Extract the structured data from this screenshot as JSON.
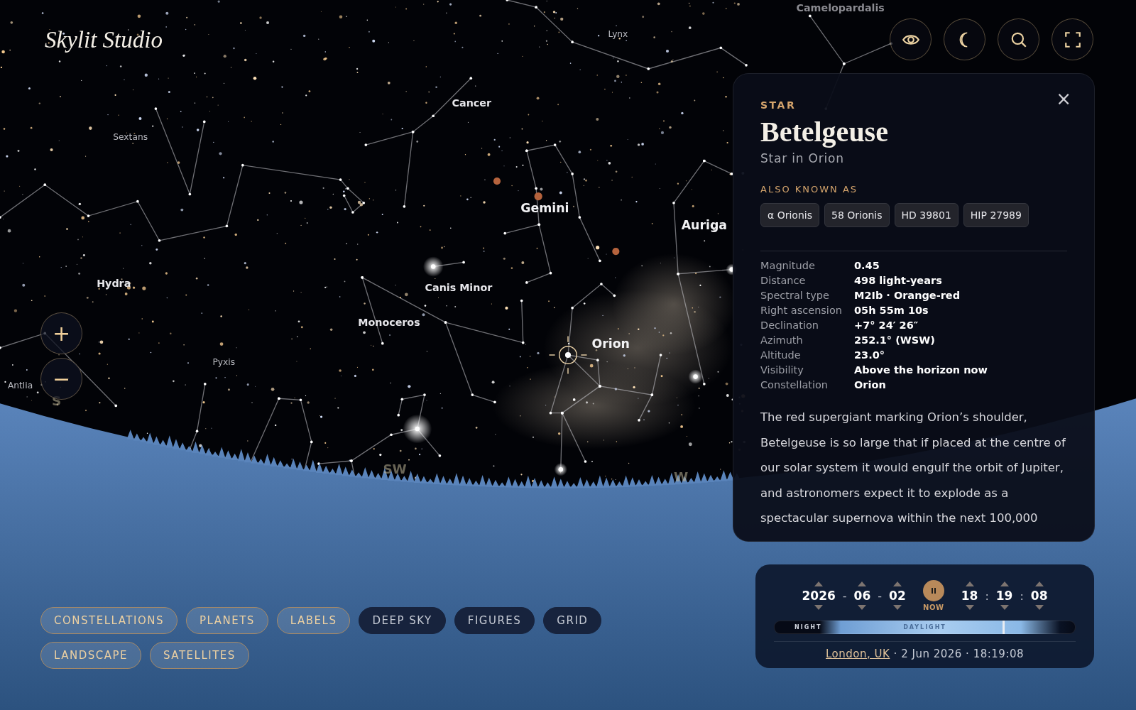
{
  "app": {
    "logo": "Skylit Studio"
  },
  "sky": {
    "constellation_labels": [
      {
        "text": "Camelopardalis",
        "kind": "faint"
      },
      {
        "text": "Lynx",
        "kind": "small"
      },
      {
        "text": "Cancer",
        "kind": "medium"
      },
      {
        "text": "Sextans",
        "kind": "small"
      },
      {
        "text": "Gemini",
        "kind": "large"
      },
      {
        "text": "Auriga",
        "kind": "large"
      },
      {
        "text": "Hydra",
        "kind": "medium"
      },
      {
        "text": "Canis Minor",
        "kind": "medium"
      },
      {
        "text": "Monoceros",
        "kind": "medium"
      },
      {
        "text": "Orion",
        "kind": "large"
      },
      {
        "text": "Pyxis",
        "kind": "small"
      },
      {
        "text": "Antlia",
        "kind": "small"
      }
    ],
    "compass": [
      "S",
      "SW",
      "W"
    ]
  },
  "zoom_controls": [
    "+",
    "−"
  ],
  "info_panel": {
    "type_label": "STAR",
    "close": "×",
    "title": "Betelgeuse",
    "subtitle": "Star in Orion",
    "aka_heading": "ALSO KNOWN AS",
    "aliases": [
      "α Orionis",
      "58 Orionis",
      "HD 39801",
      "HIP 27989"
    ],
    "properties": [
      {
        "label": "Magnitude",
        "value": "0.45"
      },
      {
        "label": "Distance",
        "value": "498 light-years"
      },
      {
        "label": "Spectral type",
        "value": "M2Ib · Orange-red"
      },
      {
        "label": "Right ascension",
        "value": "05h 55m 10s"
      },
      {
        "label": "Declination",
        "value": "+7° 24′ 26″"
      },
      {
        "label": "Azimuth",
        "value": "252.1° (WSW)"
      },
      {
        "label": "Altitude",
        "value": "23.0°"
      },
      {
        "label": "Visibility",
        "value": "Above the horizon now"
      },
      {
        "label": "Constellation",
        "value": "Orion"
      }
    ],
    "description": "The red supergiant marking Orion’s shoulder, Betelgeuse is so large that if placed at the centre of our solar system it would engulf the orbit of Jupiter, and astronomers expect it to explode as a spectacular supernova within the next 100,000"
  },
  "time_panel": {
    "fields": [
      {
        "kind": "field",
        "value": "2026"
      },
      {
        "kind": "separator",
        "value": "-"
      },
      {
        "kind": "field",
        "value": "06"
      },
      {
        "kind": "separator",
        "value": "-"
      },
      {
        "kind": "field",
        "value": "02"
      },
      {
        "kind": "now",
        "value": "NOW",
        "running": true
      },
      {
        "kind": "field",
        "value": "18"
      },
      {
        "kind": "separator",
        "value": ":"
      },
      {
        "kind": "field",
        "value": "19"
      },
      {
        "kind": "separator",
        "value": ":"
      },
      {
        "kind": "field",
        "value": "08"
      }
    ],
    "daylight": {
      "night_label": "NIGHT",
      "day_label": "DAYLIGHT",
      "level": 0.76
    },
    "location": "London, UK",
    "datetime": "· 2 Jun 2026 · 18:19:08"
  },
  "layers": [
    {
      "label": "CONSTELLATIONS",
      "on": true
    },
    {
      "label": "PLANETS",
      "on": true
    },
    {
      "label": "LABELS",
      "on": true
    },
    {
      "label": "DEEP SKY",
      "on": false
    },
    {
      "label": "FIGURES",
      "on": false
    },
    {
      "label": "GRID",
      "on": false
    },
    {
      "label": "LANDSCAPE",
      "on": true
    },
    {
      "label": "SATELLITES",
      "on": true
    }
  ]
}
